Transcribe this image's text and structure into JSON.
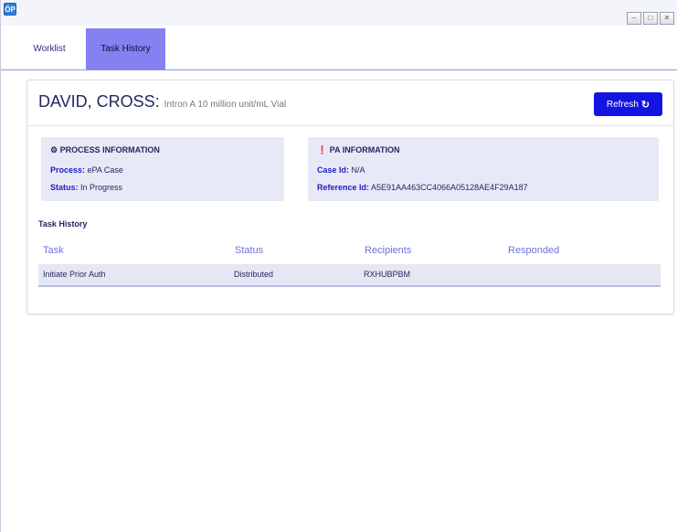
{
  "window": {
    "app_icon_text": "ÓP",
    "controls": {
      "minimize": "–",
      "maximize": "□",
      "close": "✕"
    }
  },
  "tabs": [
    {
      "label": "Worklist",
      "active": false
    },
    {
      "label": "Task History",
      "active": true
    }
  ],
  "header": {
    "patient_name": "DAVID, CROSS:",
    "drug": "Intron A 10 million unit/mL Vial",
    "refresh_label": "Refresh",
    "refresh_icon": "refresh-icon"
  },
  "process_info": {
    "title": "PROCESS INFORMATION",
    "icon": "gear-icon",
    "process_label": "Process:",
    "process_value": "ePA Case",
    "status_label": "Status:",
    "status_value": "In Progress"
  },
  "pa_info": {
    "title": "PA INFORMATION",
    "icon": "info-icon",
    "case_id_label": "Case Id:",
    "case_id_value": "N/A",
    "reference_id_label": "Reference Id:",
    "reference_id_value": "A5E91AA463CC4066A05128AE4F29A187"
  },
  "task_history": {
    "title": "Task History",
    "columns": [
      "Task",
      "Status",
      "Recipients",
      "Responded"
    ],
    "rows": [
      {
        "task": "Initiate Prior Auth",
        "status": "Distributed",
        "recipients": "RXHUBPBM",
        "responded": ""
      }
    ]
  },
  "colors": {
    "accent": "#1414e0",
    "active_tab": "#8481f0",
    "info_box": "#e8e9f7",
    "column_header": "#6f72d8",
    "dark_text": "#23285e"
  }
}
